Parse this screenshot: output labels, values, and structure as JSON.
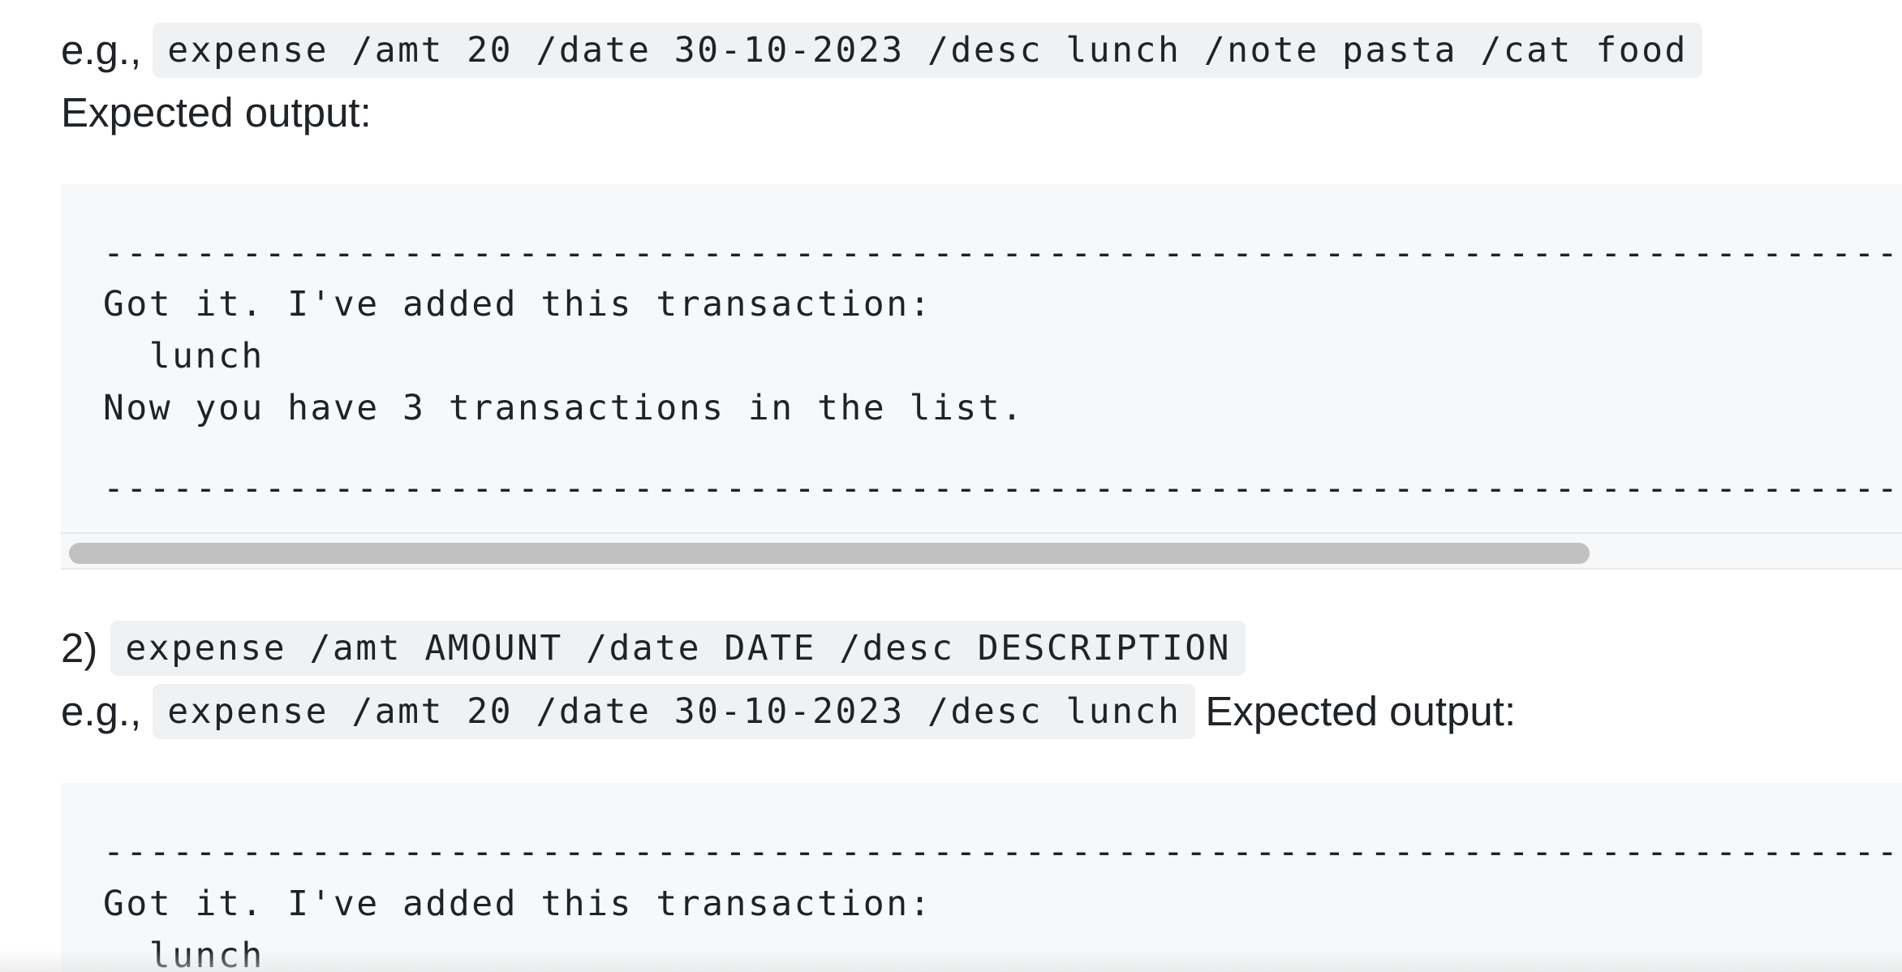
{
  "example1": {
    "prefix": "e.g.,",
    "command": "expense /amt 20 /date 30-10-2023 /desc lunch /note pasta /cat food"
  },
  "expected_output_label_1": "Expected output:",
  "output1": {
    "lines": [
      "--------------------------------------------------------------------------------------------------------",
      "Got it. I've added this transaction:",
      "  lunch",
      "Now you have 3 transactions in the list.",
      "--------------------------------------------------------------------------------------------------------"
    ]
  },
  "item2": {
    "number": "2)",
    "format": "expense /amt AMOUNT /date DATE /desc DESCRIPTION"
  },
  "example2": {
    "prefix": "e.g.,",
    "command": "expense /amt 20 /date 30-10-2023 /desc lunch",
    "expected_label": "Expected output:"
  },
  "output2": {
    "lines": [
      "--------------------------------------------------------------------------------------------------------",
      "Got it. I've added this transaction:",
      "  lunch"
    ]
  }
}
